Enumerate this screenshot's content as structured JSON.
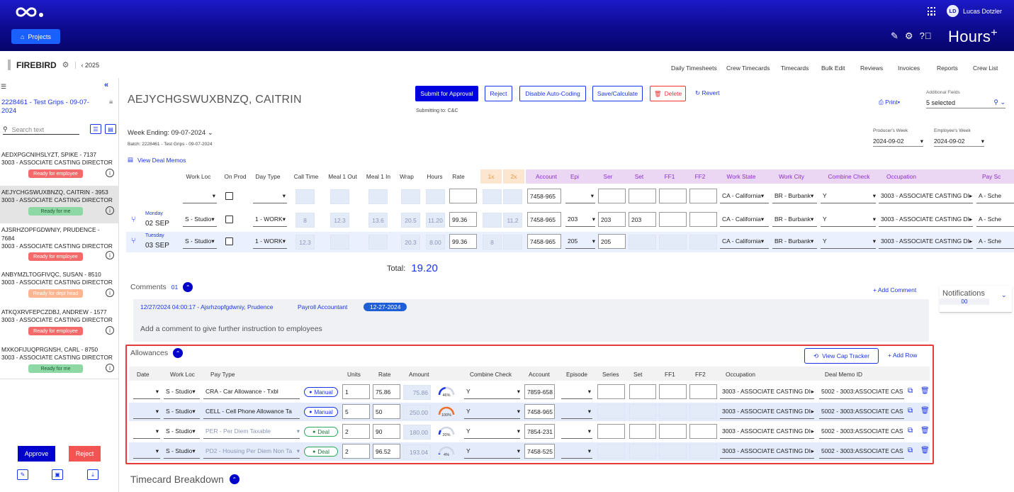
{
  "header": {
    "projects_label": "Projects",
    "user_initials": "LD",
    "user_name": "Lucas Dotzler",
    "brand": "Hours",
    "brand_sup": "+"
  },
  "subbar": {
    "project_name": "FIREBIRD",
    "year": "2025",
    "nav": [
      "Daily Timesheets",
      "Crew Timecards",
      "Timecards",
      "Bulk Edit",
      "Reviews",
      "Invoices",
      "Reports",
      "Crew List"
    ]
  },
  "sidebar": {
    "current_batch": "2228461 - Test Grips - 09-07-2024",
    "search_placeholder": "Search text",
    "employees": [
      {
        "name": "AEDXPGCNIHSLYZT, SPIKE - 7137",
        "occupation": "3003 - ASSOCIATE CASTING DIRECTOR",
        "status": "Ready for employee",
        "status_type": "red"
      },
      {
        "name": "AEJYCHGSWUXBNZQ, CAITRIN - 3953",
        "occupation": "3003 - ASSOCIATE CASTING DIRECTOR",
        "status": "Ready for me",
        "status_type": "green"
      },
      {
        "name": "AJSRHZOPFGDWNIY, PRUDENCE - 7684",
        "occupation": "3003 - ASSOCIATE CASTING DIRECTOR",
        "status": "Ready for employee",
        "status_type": "red"
      },
      {
        "name": "ANBYMZLTOGFIVQC, SUSAN - 8510",
        "occupation": "3003 - ASSOCIATE CASTING DIRECTOR",
        "status": "Ready for dept head",
        "status_type": "orange"
      },
      {
        "name": "ATKQXRVFEPCZDBJ, ANDREW - 1577",
        "occupation": "3003 - ASSOCIATE CASTING DIRECTOR",
        "status": "Ready for employee",
        "status_type": "red"
      },
      {
        "name": "MXKOFIJUQPRGNSH, CARL - 8750",
        "occupation": "3003 - ASSOCIATE CASTING DIRECTOR",
        "status": "Ready for me",
        "status_type": "green"
      }
    ],
    "approve_label": "Approve",
    "reject_label": "Reject"
  },
  "timecard": {
    "employee_title": "AEJYCHGSWUXBNZQ, CAITRIN",
    "buttons": {
      "submit": "Submit for Approval",
      "reject": "Reject",
      "disable_auto": "Disable Auto-Coding",
      "save": "Save/Calculate",
      "delete": "Delete",
      "revert": "Revert",
      "print": "Print"
    },
    "submitting_to": "Submitting to: C&C",
    "additional_fields_label": "Additional Fields",
    "additional_fields_value": "5 selected",
    "week_ending": "Week Ending: 09-07-2024",
    "batch": "Batch: 2228461 - Test Grips - 09-07-2024",
    "producers_week_label": "Producer's Week",
    "producers_week_value": "2024-09-02",
    "employees_week_label": "Employee's Week",
    "employees_week_value": "2024-09-02",
    "view_deal_memos": "View Deal Memos",
    "columns": {
      "work_loc": "Work Loc",
      "on_prod": "On Prod",
      "day_type": "Day Type",
      "call_time": "Call Time",
      "meal1_out": "Meal 1 Out",
      "meal1_in": "Meal 1 In",
      "wrap": "Wrap",
      "hours": "Hours",
      "rate": "Rate",
      "x1": "1x",
      "x2": "2x",
      "account": "Account",
      "epi": "Epi",
      "ser": "Ser",
      "set": "Set",
      "ff1": "FF1",
      "ff2": "FF2",
      "work_state": "Work State",
      "work_city": "Work City",
      "combine_check": "Combine Check",
      "occupation": "Occupation",
      "pay_schedule": "Pay Sc"
    },
    "master_row": {
      "account": "7458-965",
      "work_state": "CA - California",
      "work_city": "BR - Burbank",
      "combine": "Y",
      "occupation": "3003 - ASSOCIATE CASTING DI",
      "pay": "A - Sche"
    },
    "days": [
      {
        "day": "Monday",
        "date": "02 SEP",
        "work_loc": "S - Studio",
        "day_type": "1 - WORK",
        "call": "8",
        "meal_out": "12.3",
        "meal_in": "13.6",
        "wrap": "20.5",
        "hours": "11.20",
        "rate": "99.36",
        "x1": "",
        "x2": "11.2",
        "account": "7458-965",
        "epi": "203",
        "ser": "203",
        "set": "203",
        "work_state": "CA - California",
        "work_city": "BR - Burbank",
        "combine": "Y",
        "occupation": "3003 - ASSOCIATE CASTING DI",
        "pay": "A - Sche"
      },
      {
        "day": "Tuesday",
        "date": "03 SEP",
        "work_loc": "S - Studio",
        "day_type": "1 - WORK",
        "call": "12.3",
        "meal_out": "",
        "meal_in": "",
        "wrap": "20.3",
        "hours": "8.00",
        "rate": "99.36",
        "x1": "8",
        "x2": "",
        "account": "7458-965",
        "epi": "205",
        "ser": "205",
        "set": "",
        "work_state": "CA - California",
        "work_city": "BR - Burbank",
        "combine": "Y",
        "occupation": "3003 - ASSOCIATE CASTING DI",
        "pay": "A - Sche"
      }
    ],
    "total_label": "Total:",
    "total_value": "19.20"
  },
  "comments": {
    "title": "Comments",
    "count": "01",
    "add_label": "+ Add Comment",
    "entry_meta": "12/27/2024 04:00:17 - Ajsrhzopfgdwniy, Prudence",
    "entry_role": "Payroll Accountant",
    "entry_date": "12-27-2024",
    "placeholder": "Add a comment to give further instruction to employees"
  },
  "notifications": {
    "title": "Notifications",
    "count": "00"
  },
  "allowances": {
    "title": "Allowances",
    "view_cap": "View Cap Tracker",
    "add_row": "+ Add Row",
    "columns": [
      "Date",
      "Work Loc",
      "Pay Type",
      "Units",
      "Rate",
      "Amount",
      "Combine Check",
      "Account",
      "Episode",
      "Series",
      "Set",
      "FF1",
      "FF2",
      "Occupation",
      "Deal Memo ID"
    ],
    "rows": [
      {
        "work_loc": "S - Studio",
        "pay_type": "CRA - Car Allowance - Txbl",
        "pay_disabled": false,
        "source": "Manual",
        "units": "1",
        "rate": "75.86",
        "amount": "75.86",
        "gauge": "46%",
        "gauge_pct": 46,
        "combine": "Y",
        "account": "7859-658",
        "occupation": "3003 - ASSOCIATE CASTING DI",
        "deal": "5002 - 3003:ASSOCIATE CAS"
      },
      {
        "work_loc": "S - Studio",
        "pay_type": "CELL - Cell Phone Allowance Ta",
        "pay_disabled": false,
        "source": "Manual",
        "units": "5",
        "rate": "50",
        "amount": "250.00",
        "gauge": "100%",
        "gauge_pct": 100,
        "combine": "Y",
        "account": "7458-965",
        "occupation": "3003 - ASSOCIATE CASTING DI",
        "deal": "5002 - 3003:ASSOCIATE CAS"
      },
      {
        "work_loc": "S - Studio",
        "pay_type": "PER - Per Diem Taxable",
        "pay_disabled": true,
        "source": "Deal",
        "units": "2",
        "rate": "90",
        "amount": "180.00",
        "gauge": "20%",
        "gauge_pct": 20,
        "combine": "Y",
        "account": "7854-231",
        "occupation": "3003 - ASSOCIATE CASTING DI",
        "deal": "5002 - 3003:ASSOCIATE CAS"
      },
      {
        "work_loc": "S - Studio",
        "pay_type": "PD2 - Housing Per Diem Non Ta",
        "pay_disabled": true,
        "source": "Deal",
        "units": "2",
        "rate": "96.52",
        "amount": "193.04",
        "gauge": "4%",
        "gauge_pct": 4,
        "combine": "Y",
        "account": "7458-525",
        "occupation": "3003 - ASSOCIATE CASTING DI",
        "deal": "5002 - 3003:ASSOCIATE CAS"
      }
    ]
  },
  "breakdown": {
    "title": "Timecard Breakdown"
  }
}
